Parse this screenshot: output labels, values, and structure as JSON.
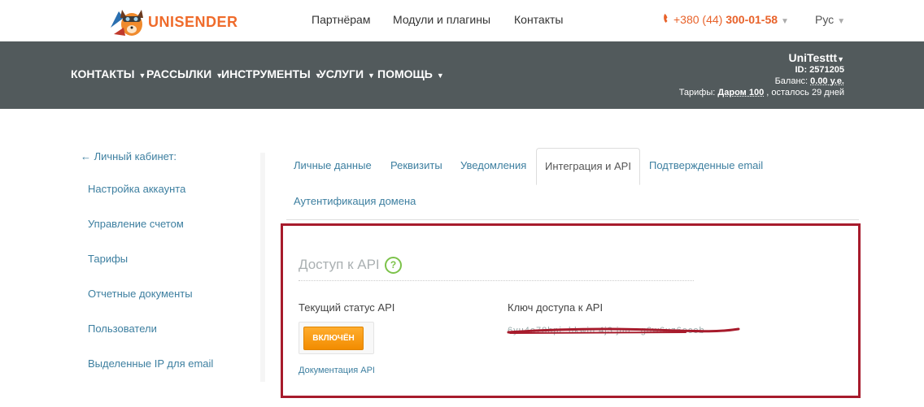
{
  "brand": {
    "logo_text": "UNISENDER"
  },
  "top_nav": [
    {
      "label": "Партнёрам"
    },
    {
      "label": "Модули и плагины"
    },
    {
      "label": "Контакты"
    }
  ],
  "phone": {
    "prefix": "+380 (44) ",
    "number": "300-01-58"
  },
  "language": {
    "label": "Рус"
  },
  "main_nav": [
    {
      "label": "КОНТАКТЫ"
    },
    {
      "label": "РАССЫЛКИ"
    },
    {
      "label": "ИНСТРУМЕНТЫ"
    },
    {
      "label": "УСЛУГИ"
    },
    {
      "label": "ПОМОЩЬ"
    }
  ],
  "user": {
    "name": "UniTesttt",
    "id_text": "ID: 2571205",
    "balance_label": "Баланс: ",
    "balance_value": "0.00 у.е.",
    "tariff_label": "Тарифы: ",
    "tariff_value": "Даром 100",
    "tariff_rest": " , осталось 29 дней"
  },
  "sidebar": {
    "back_label": "← Личный кабинет:",
    "items": [
      {
        "label": "Настройка аккаунта"
      },
      {
        "label": "Управление счетом"
      },
      {
        "label": "Тарифы"
      },
      {
        "label": "Отчетные документы"
      },
      {
        "label": "Пользователи"
      },
      {
        "label": "Выделенные IP для email"
      }
    ]
  },
  "tabs": [
    {
      "label": "Личные данные"
    },
    {
      "label": "Реквизиты"
    },
    {
      "label": "Уведомления"
    },
    {
      "label": "Интеграция и API",
      "active": true
    },
    {
      "label": "Подтвержденные email"
    },
    {
      "label": "Аутентификация домена"
    }
  ],
  "api_panel": {
    "title": "Доступ к API",
    "help_glyph": "?",
    "status_label": "Текущий статус API",
    "status_button": "ВКЛЮЧЁН",
    "docs_link": "Документация API",
    "key_label": "Ключ доступа к API",
    "key_value": "6yu4e78hpi..bkwin 4j3 juu...g6w6uz6ecob"
  },
  "colors": {
    "accent_orange": "#ef6b2b",
    "nav_dark": "#525a5c",
    "link_blue": "#3d7fa0",
    "highlight_red": "#a71b2c",
    "help_green": "#7cc24a"
  }
}
